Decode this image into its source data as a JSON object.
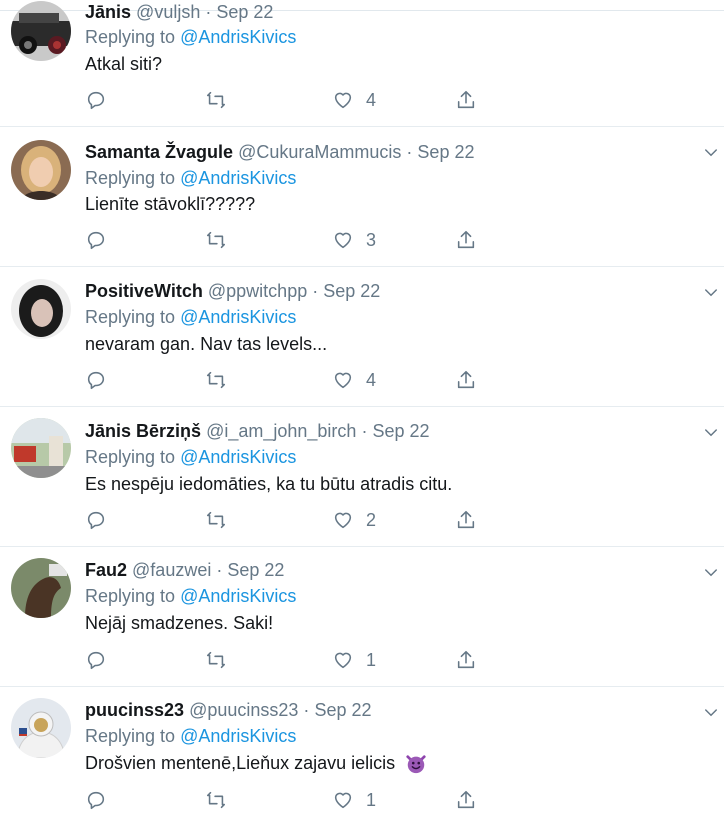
{
  "colors": {
    "link": "#1b95e0",
    "muted": "#657786",
    "text": "#14171a",
    "divider": "#e6ecf0"
  },
  "tweets": [
    {
      "name": "Jānis",
      "handle": "@vuljsh",
      "dot": "·",
      "date": "Sep 22",
      "replying_prefix": "Replying to",
      "replying_to": "@AndrisKivics",
      "text": "Atkal siti?",
      "likes": "4",
      "avatar_icon": "car-avatar"
    },
    {
      "name": "Samanta Žvagule",
      "handle": "@CukuraMammucis",
      "dot": "·",
      "date": "Sep 22",
      "replying_prefix": "Replying to",
      "replying_to": "@AndrisKivics",
      "text": "Lienīte stāvoklī?????",
      "likes": "3",
      "avatar_icon": "person-avatar"
    },
    {
      "name": "PositiveWitch",
      "handle": "@ppwitchpp",
      "dot": "·",
      "date": "Sep 22",
      "replying_prefix": "Replying to",
      "replying_to": "@AndrisKivics",
      "text": "nevaram gan. Nav tas levels...",
      "likes": "4",
      "avatar_icon": "person-avatar"
    },
    {
      "name": "Jānis Bērziņš",
      "handle": "@i_am_john_birch",
      "dot": "·",
      "date": "Sep 22",
      "replying_prefix": "Replying to",
      "replying_to": "@AndrisKivics",
      "text": "Es nespēju iedomāties, ka tu būtu atradis citu.",
      "likes": "2",
      "avatar_icon": "street-avatar"
    },
    {
      "name": "Fau2",
      "handle": "@fauzwei",
      "dot": "·",
      "date": "Sep 22",
      "replying_prefix": "Replying to",
      "replying_to": "@AndrisKivics",
      "text": "Nejāj smadzenes. Saki!",
      "likes": "1",
      "avatar_icon": "horse-avatar"
    },
    {
      "name": "puucinss23",
      "handle": "@puucinss23",
      "dot": "·",
      "date": "Sep 22",
      "replying_prefix": "Replying to",
      "replying_to": "@AndrisKivics",
      "text": "Drošvien mentenē,Lieňux zajavu ielicis",
      "likes": "1",
      "avatar_icon": "astronaut-avatar",
      "emoji": "smiling-devil-emoji"
    }
  ]
}
